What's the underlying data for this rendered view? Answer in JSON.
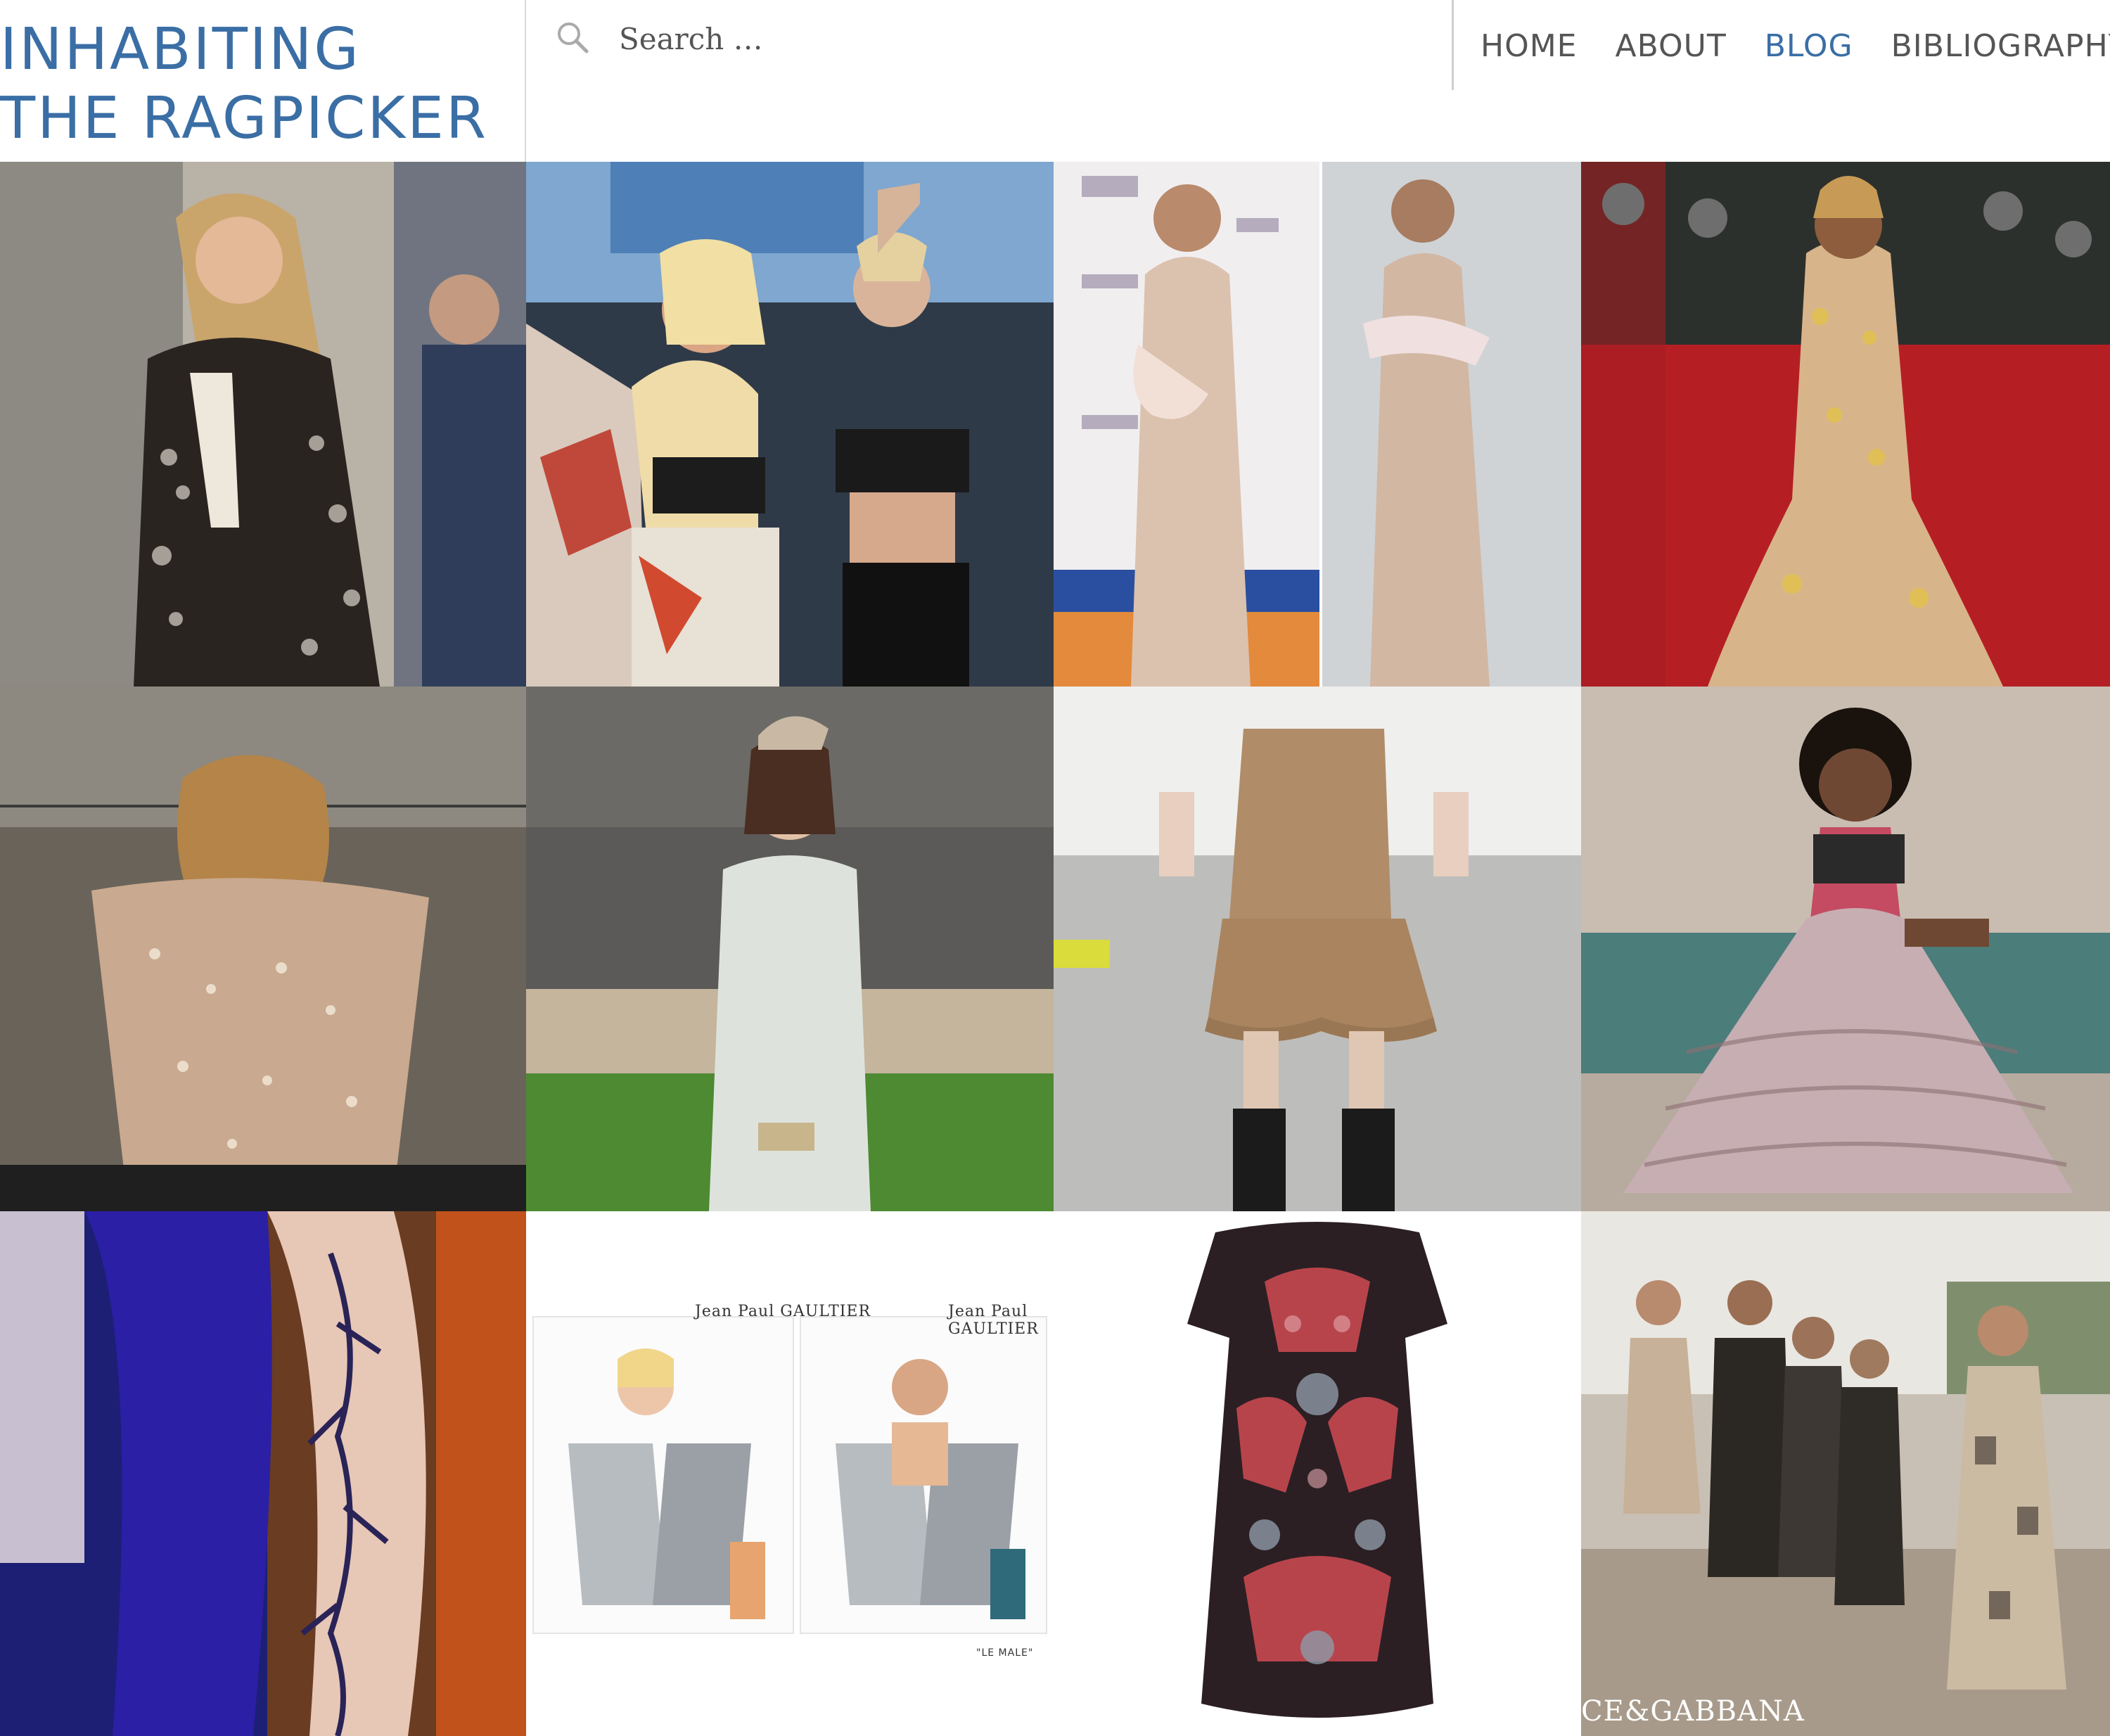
{
  "site": {
    "title_line1": "INHABITING",
    "title_line2": "THE RAGPICKER"
  },
  "search": {
    "placeholder": "Search …",
    "icon": "search-icon"
  },
  "nav": {
    "items": [
      {
        "label": "HOME",
        "active": false
      },
      {
        "label": "ABOUT",
        "active": false
      },
      {
        "label": "BLOG",
        "active": true
      },
      {
        "label": "BIBLIOGRAPHY",
        "active": false
      }
    ]
  },
  "colors": {
    "brand": "#3a6ea5",
    "nav_text": "#555555",
    "divider": "#d9d9d9"
  },
  "gallery": {
    "tiles": [
      {
        "name": "sequin-blazer-photo"
      },
      {
        "name": "concert-duo-photo"
      },
      {
        "name": "crystal-gown-photo"
      },
      {
        "name": "red-carpet-gown-photo"
      },
      {
        "name": "sequin-top-scene-photo"
      },
      {
        "name": "tweed-coat-photo"
      },
      {
        "name": "runway-ruffle-shorts-photo"
      },
      {
        "name": "tulle-ballgown-photo"
      },
      {
        "name": "blue-beaded-gown-photo"
      },
      {
        "name": "fragrance-ad-photo",
        "ad_text_1": "Jean Paul GAULTIER",
        "ad_text_2": "Jean Paul GAULTIER",
        "ad_caption": "\"LE MALE\""
      },
      {
        "name": "printed-dress-photo"
      },
      {
        "name": "group-campaign-photo",
        "brand_text": "CE&GABBANA"
      }
    ]
  }
}
